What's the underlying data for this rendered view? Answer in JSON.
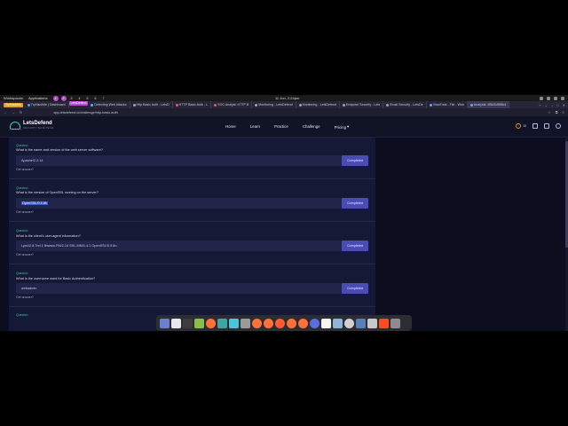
{
  "workspace_bar": {
    "workspaces_label": "Workspaces",
    "applications_label": "Applications",
    "numbers": [
      "1",
      "2",
      "3",
      "4",
      "5",
      "6",
      "7"
    ],
    "active": [
      "1",
      "2"
    ],
    "clock": "11 Jun, 2:24pm"
  },
  "tabs": {
    "bookmarks": [
      {
        "label": "TryHackMe",
        "color": "#e0a028"
      },
      {
        "label": "LetsDefend",
        "color": "#b84bd0"
      }
    ],
    "items": [
      {
        "label": "TryHackMe | Dashboard",
        "color": "#4da3ff"
      },
      {
        "label": "Detecting Web Attacks",
        "color": "#6aa0ff"
      },
      {
        "label": "Http Basic Auth - LetsD",
        "color": "#9aa0c0"
      },
      {
        "label": "HTTP Basic Auth - L",
        "color": "#ff4d6a"
      },
      {
        "label": "SOC Analyst: HTTP B",
        "color": "#ff4d6a"
      },
      {
        "label": "Monitoring - LetsDefend",
        "color": "#9aa0c0"
      },
      {
        "label": "Monitoring - LetsDefend",
        "color": "#9aa0c0"
      },
      {
        "label": "Endpoint Security - Lets",
        "color": "#9aa0c0"
      },
      {
        "label": "Email Security - LetsDe",
        "color": "#9aa0c0"
      },
      {
        "label": "VirusTotal - File - Web",
        "color": "#6aa0ff"
      },
      {
        "label": "Analysis: 4f6d3cf6f6b4",
        "color": "#6aa0ff"
      }
    ],
    "active_index": 10
  },
  "urlbar": {
    "url": "app.letsdefend.io/challenge/http-basic-auth"
  },
  "header": {
    "logo_name": "LetsDefend",
    "logo_sub": "SECURITY BLUE TEAM",
    "nav": [
      "Home",
      "Learn",
      "Practice",
      "Challenge",
      "Pricing"
    ],
    "pricing_caret": "▾",
    "notif_count": "10"
  },
  "questions": [
    {
      "badge": "Question",
      "text": "What is the name and version of the web server software?",
      "answer_prefix": "Apache/2.2.14",
      "answer_selected": "",
      "answer_suffix": "",
      "button": "Completed",
      "hint": "Get answer?"
    },
    {
      "badge": "Question",
      "text": "What is the version of OpenSSL running on the server?",
      "answer_prefix": "",
      "answer_selected": "OpenSSL/0.9.8k",
      "answer_suffix": "",
      "button": "Completed",
      "hint": "Get answer?"
    },
    {
      "badge": "Question",
      "text": "What is the client's user-agent information?",
      "answer_prefix": "Lynx/2.8.7rel.1 libwww-FM/2.14 SSL-MM/1.4.1 OpenSSL/0.9.8n",
      "answer_selected": "",
      "answer_suffix": "",
      "button": "Completed",
      "hint": "Get answer?"
    },
    {
      "badge": "Question",
      "text": "What is the username used for Basic Authentication?",
      "answer_prefix": "webadmin",
      "answer_selected": "",
      "answer_suffix": "",
      "button": "Completed",
      "hint": "Get answer?"
    }
  ],
  "next_question_badge": "Question",
  "dock": {
    "icons": [
      {
        "name": "system-icon",
        "color": "#6a7fd1"
      },
      {
        "name": "files-icon",
        "color": "#e9e9e9"
      },
      {
        "name": "terminal-icon",
        "color": "#3d3d3d"
      },
      {
        "name": "apps-grid-icon",
        "color": "#8bbd4a"
      },
      {
        "name": "firefox-icon",
        "color": "#ff7139"
      },
      {
        "name": "folder-icon",
        "color": "#3ba7a0"
      },
      {
        "name": "screenshot-icon",
        "color": "#48c7d8"
      },
      {
        "name": "settings-icon",
        "color": "#9a9a9a"
      },
      {
        "name": "firefox-icon",
        "color": "#ff7139"
      },
      {
        "name": "firefox-icon",
        "color": "#ff7139"
      },
      {
        "name": "firefox-icon",
        "color": "#ff5a36"
      },
      {
        "name": "firefox-icon",
        "color": "#ff7139"
      },
      {
        "name": "firefox-icon",
        "color": "#ff7139"
      },
      {
        "name": "chromium-icon",
        "color": "#5b6ee1"
      },
      {
        "name": "github-icon",
        "color": "#f5f5f5"
      },
      {
        "name": "steam-icon",
        "color": "#8fb4d9"
      },
      {
        "name": "help-icon",
        "color": "#d0d0d0"
      },
      {
        "name": "wireshark-icon",
        "color": "#5a7fb8"
      },
      {
        "name": "text-editor-icon",
        "color": "#c8c8c8"
      },
      {
        "name": "burp-icon",
        "color": "#ff4b1f"
      },
      {
        "name": "more-icon",
        "color": "#8c8c8c"
      }
    ]
  }
}
